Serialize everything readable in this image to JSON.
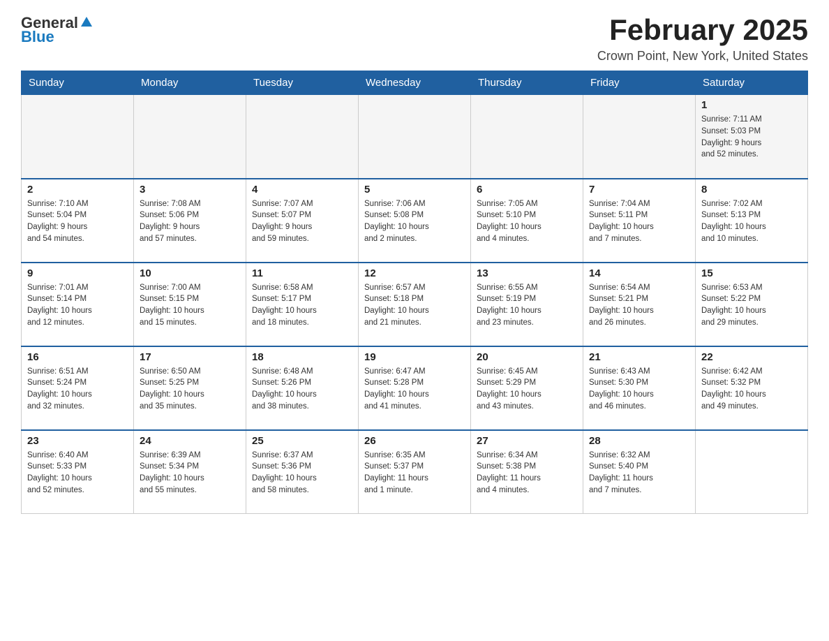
{
  "header": {
    "logo_general": "General",
    "logo_blue": "Blue",
    "month_title": "February 2025",
    "location": "Crown Point, New York, United States"
  },
  "days_of_week": [
    "Sunday",
    "Monday",
    "Tuesday",
    "Wednesday",
    "Thursday",
    "Friday",
    "Saturday"
  ],
  "weeks": [
    [
      {
        "day": "",
        "info": ""
      },
      {
        "day": "",
        "info": ""
      },
      {
        "day": "",
        "info": ""
      },
      {
        "day": "",
        "info": ""
      },
      {
        "day": "",
        "info": ""
      },
      {
        "day": "",
        "info": ""
      },
      {
        "day": "1",
        "info": "Sunrise: 7:11 AM\nSunset: 5:03 PM\nDaylight: 9 hours\nand 52 minutes."
      }
    ],
    [
      {
        "day": "2",
        "info": "Sunrise: 7:10 AM\nSunset: 5:04 PM\nDaylight: 9 hours\nand 54 minutes."
      },
      {
        "day": "3",
        "info": "Sunrise: 7:08 AM\nSunset: 5:06 PM\nDaylight: 9 hours\nand 57 minutes."
      },
      {
        "day": "4",
        "info": "Sunrise: 7:07 AM\nSunset: 5:07 PM\nDaylight: 9 hours\nand 59 minutes."
      },
      {
        "day": "5",
        "info": "Sunrise: 7:06 AM\nSunset: 5:08 PM\nDaylight: 10 hours\nand 2 minutes."
      },
      {
        "day": "6",
        "info": "Sunrise: 7:05 AM\nSunset: 5:10 PM\nDaylight: 10 hours\nand 4 minutes."
      },
      {
        "day": "7",
        "info": "Sunrise: 7:04 AM\nSunset: 5:11 PM\nDaylight: 10 hours\nand 7 minutes."
      },
      {
        "day": "8",
        "info": "Sunrise: 7:02 AM\nSunset: 5:13 PM\nDaylight: 10 hours\nand 10 minutes."
      }
    ],
    [
      {
        "day": "9",
        "info": "Sunrise: 7:01 AM\nSunset: 5:14 PM\nDaylight: 10 hours\nand 12 minutes."
      },
      {
        "day": "10",
        "info": "Sunrise: 7:00 AM\nSunset: 5:15 PM\nDaylight: 10 hours\nand 15 minutes."
      },
      {
        "day": "11",
        "info": "Sunrise: 6:58 AM\nSunset: 5:17 PM\nDaylight: 10 hours\nand 18 minutes."
      },
      {
        "day": "12",
        "info": "Sunrise: 6:57 AM\nSunset: 5:18 PM\nDaylight: 10 hours\nand 21 minutes."
      },
      {
        "day": "13",
        "info": "Sunrise: 6:55 AM\nSunset: 5:19 PM\nDaylight: 10 hours\nand 23 minutes."
      },
      {
        "day": "14",
        "info": "Sunrise: 6:54 AM\nSunset: 5:21 PM\nDaylight: 10 hours\nand 26 minutes."
      },
      {
        "day": "15",
        "info": "Sunrise: 6:53 AM\nSunset: 5:22 PM\nDaylight: 10 hours\nand 29 minutes."
      }
    ],
    [
      {
        "day": "16",
        "info": "Sunrise: 6:51 AM\nSunset: 5:24 PM\nDaylight: 10 hours\nand 32 minutes."
      },
      {
        "day": "17",
        "info": "Sunrise: 6:50 AM\nSunset: 5:25 PM\nDaylight: 10 hours\nand 35 minutes."
      },
      {
        "day": "18",
        "info": "Sunrise: 6:48 AM\nSunset: 5:26 PM\nDaylight: 10 hours\nand 38 minutes."
      },
      {
        "day": "19",
        "info": "Sunrise: 6:47 AM\nSunset: 5:28 PM\nDaylight: 10 hours\nand 41 minutes."
      },
      {
        "day": "20",
        "info": "Sunrise: 6:45 AM\nSunset: 5:29 PM\nDaylight: 10 hours\nand 43 minutes."
      },
      {
        "day": "21",
        "info": "Sunrise: 6:43 AM\nSunset: 5:30 PM\nDaylight: 10 hours\nand 46 minutes."
      },
      {
        "day": "22",
        "info": "Sunrise: 6:42 AM\nSunset: 5:32 PM\nDaylight: 10 hours\nand 49 minutes."
      }
    ],
    [
      {
        "day": "23",
        "info": "Sunrise: 6:40 AM\nSunset: 5:33 PM\nDaylight: 10 hours\nand 52 minutes."
      },
      {
        "day": "24",
        "info": "Sunrise: 6:39 AM\nSunset: 5:34 PM\nDaylight: 10 hours\nand 55 minutes."
      },
      {
        "day": "25",
        "info": "Sunrise: 6:37 AM\nSunset: 5:36 PM\nDaylight: 10 hours\nand 58 minutes."
      },
      {
        "day": "26",
        "info": "Sunrise: 6:35 AM\nSunset: 5:37 PM\nDaylight: 11 hours\nand 1 minute."
      },
      {
        "day": "27",
        "info": "Sunrise: 6:34 AM\nSunset: 5:38 PM\nDaylight: 11 hours\nand 4 minutes."
      },
      {
        "day": "28",
        "info": "Sunrise: 6:32 AM\nSunset: 5:40 PM\nDaylight: 11 hours\nand 7 minutes."
      },
      {
        "day": "",
        "info": ""
      }
    ]
  ]
}
